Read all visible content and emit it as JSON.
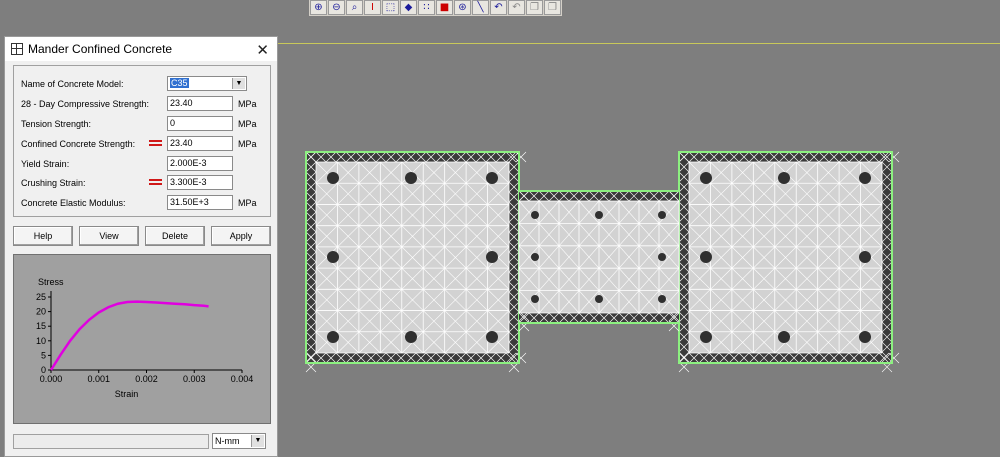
{
  "toolbar": {
    "buttons": [
      {
        "name": "zoom-in-icon",
        "glyph": "⊕"
      },
      {
        "name": "zoom-out-icon",
        "glyph": "⊖"
      },
      {
        "name": "zoom-window-icon",
        "glyph": "⌕"
      },
      {
        "name": "i-beam-icon",
        "glyph": "I"
      },
      {
        "name": "select-icon",
        "glyph": "⬚"
      },
      {
        "name": "shape-icon",
        "glyph": "◆"
      },
      {
        "name": "points-icon",
        "glyph": "∷"
      },
      {
        "name": "color-icon",
        "glyph": "■"
      },
      {
        "name": "bars-icon",
        "glyph": "⊛"
      },
      {
        "name": "line-icon",
        "glyph": "╲"
      },
      {
        "name": "arc-icon",
        "glyph": "↶"
      },
      {
        "name": "undo-icon",
        "glyph": "↶"
      },
      {
        "name": "copy-icon",
        "glyph": "❐"
      },
      {
        "name": "paste-icon",
        "glyph": "❐"
      }
    ]
  },
  "dialog": {
    "title": "Mander Confined Concrete",
    "close_glyph": "✕",
    "fields": {
      "model_label": "Name of Concrete Model:",
      "model_value": "C35",
      "compressive_label": "28 - Day Compressive Strength:",
      "compressive_value": "23.40",
      "compressive_unit": "MPa",
      "tension_label": "Tension Strength:",
      "tension_value": "0",
      "tension_unit": "MPa",
      "confined_label": "Confined Concrete Strength:",
      "confined_value": "23.40",
      "confined_unit": "MPa",
      "yield_label": "Yield Strain:",
      "yield_value": "2.000E-3",
      "crushing_label": "Crushing Strain:",
      "crushing_value": "3.300E-3",
      "modulus_label": "Concrete Elastic Modulus:",
      "modulus_value": "31.50E+3",
      "modulus_unit": "MPa"
    },
    "buttons": {
      "help": "Help",
      "view": "View",
      "delete": "Delete",
      "apply": "Apply"
    },
    "units_value": "N-mm",
    "dropdown_glyph": "▼"
  },
  "chart_data": {
    "type": "line",
    "xlabel": "Strain",
    "ylabel": "Stress",
    "xlim": [
      0,
      0.004
    ],
    "ylim": [
      0,
      25
    ],
    "xticks": [
      "0.000",
      "0.001",
      "0.002",
      "0.003",
      "0.004"
    ],
    "yticks": [
      "0",
      "5",
      "10",
      "15",
      "20",
      "25"
    ],
    "series": [
      {
        "color": "#e000e0",
        "x": [
          0,
          0.0002,
          0.0004,
          0.0006,
          0.0008,
          0.001,
          0.0012,
          0.0014,
          0.0016,
          0.0018,
          0.002,
          0.0022,
          0.0024,
          0.0026,
          0.0028,
          0.003,
          0.0032,
          0.0033
        ],
        "y": [
          0,
          5.2,
          10,
          14,
          17.2,
          19.7,
          21.5,
          22.7,
          23.3,
          23.4,
          23.3,
          23.1,
          22.9,
          22.7,
          22.5,
          22.2,
          22.0,
          21.8
        ]
      }
    ]
  },
  "colors": {
    "edge": "#8cf080",
    "cover": "#3a3a3a",
    "core": "#d2d2d2",
    "bar": "#303030",
    "grid": "#ffffff"
  }
}
